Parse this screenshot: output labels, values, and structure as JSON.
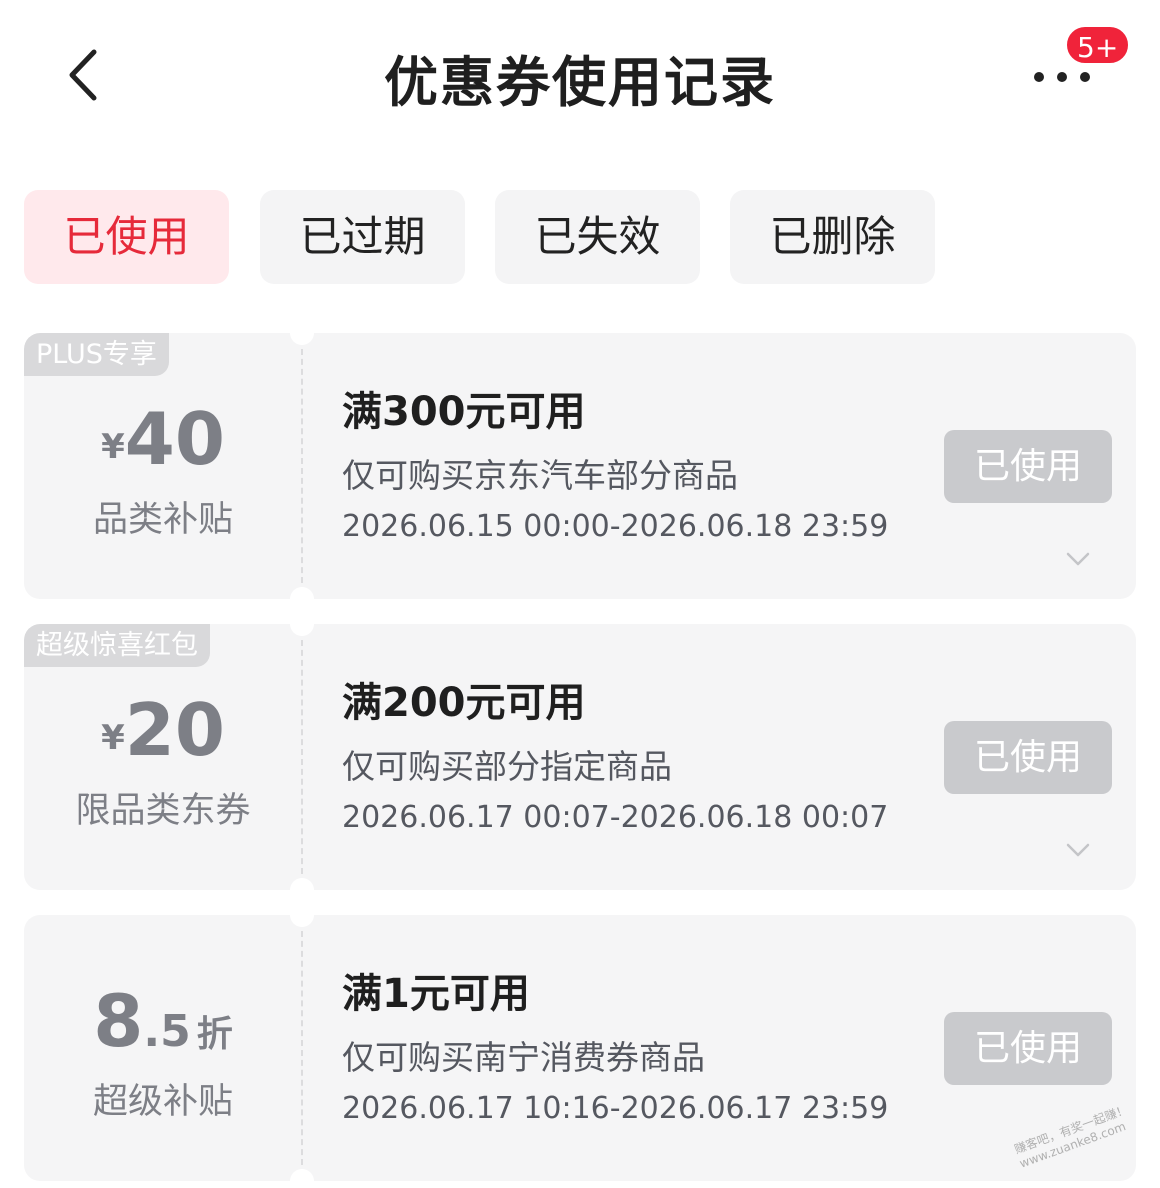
{
  "header": {
    "title": "优惠券使用记录",
    "badge": "5+",
    "icons": {
      "back": "chevron-left-icon",
      "more": "more-dots-icon"
    }
  },
  "tabs": [
    {
      "label": "已使用",
      "active": true
    },
    {
      "label": "已过期",
      "active": false
    },
    {
      "label": "已失效",
      "active": false
    },
    {
      "label": "已删除",
      "active": false
    }
  ],
  "coupons": [
    {
      "tag": "PLUS专享",
      "currency": "¥",
      "value": "40",
      "sublabel": "品类补贴",
      "condition": "满300元可用",
      "scope": "仅可购买京东汽车部分商品",
      "date": "2026.06.15 00:00-2026.06.18 23:59",
      "status": "已使用"
    },
    {
      "tag": "超级惊喜红包",
      "currency": "¥",
      "value": "20",
      "sublabel": "限品类东券",
      "condition": "满200元可用",
      "scope": "仅可购买部分指定商品",
      "date": "2026.06.17 00:07-2026.06.18 00:07",
      "status": "已使用"
    },
    {
      "tag": "",
      "value": "8",
      "decimal": ".5",
      "unit": "折",
      "sublabel": "超级补贴",
      "condition": "满1元可用",
      "scope": "仅可购买南宁消费券商品",
      "date": "2026.06.17 10:16-2026.06.17 23:59",
      "status": "已使用"
    }
  ],
  "watermark": {
    "line1": "赚客吧，有奖一起赚！",
    "line2": "www.zuanke8.com"
  },
  "colors": {
    "accent": "#e62a3a",
    "active_tab_bg": "#ffe9ec",
    "badge": "#f0233a",
    "card_bg": "#f5f5f6",
    "muted": "#7d7f86",
    "used_button": "#c9cacd"
  }
}
